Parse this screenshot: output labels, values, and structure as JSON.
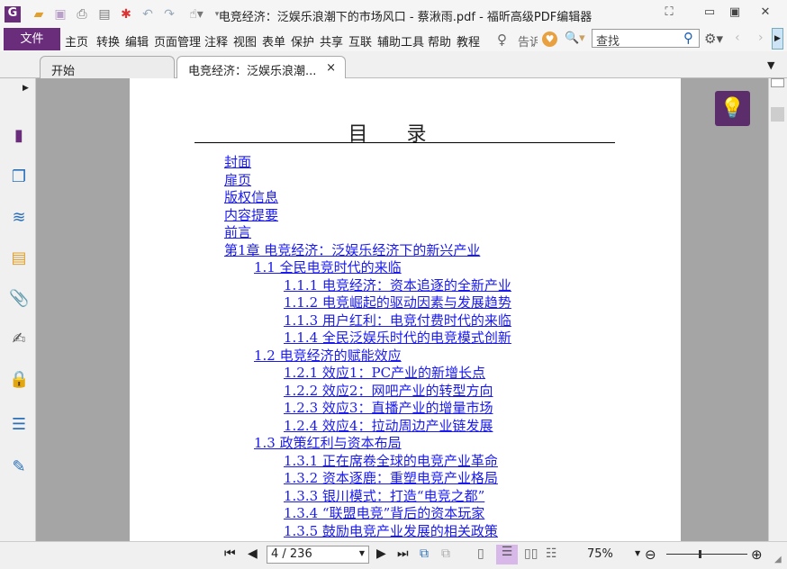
{
  "window": {
    "title": "电竞经济：泛娱乐浪潮下的市场风口 - 蔡湫雨.pdf - 福昕高级PDF编辑器"
  },
  "menu": {
    "file": "文件",
    "items": [
      "主页",
      "转换",
      "编辑",
      "页面管理",
      "注释",
      "视图",
      "表单",
      "保护",
      "共享",
      "互联",
      "辅助工具",
      "帮助",
      "教程"
    ],
    "tell": "告诉",
    "search_placeholder": "查找"
  },
  "tabs": [
    {
      "label": "开始"
    },
    {
      "label": "电竞经济：泛娱乐浪潮...",
      "close": "×"
    }
  ],
  "document": {
    "heading": "目 录",
    "toc": [
      {
        "level": 0,
        "text": "封面"
      },
      {
        "level": 0,
        "text": "扉页"
      },
      {
        "level": 0,
        "text": "版权信息"
      },
      {
        "level": 0,
        "text": "内容提要"
      },
      {
        "level": 0,
        "text": "前言"
      },
      {
        "level": 0,
        "text": "第1章 电竞经济：泛娱乐经济下的新兴产业"
      },
      {
        "level": 1,
        "text": "1.1 全民电竞时代的来临"
      },
      {
        "level": 2,
        "text": "1.1.1 电竞经济：资本追逐的全新产业"
      },
      {
        "level": 2,
        "text": "1.1.2 电竞崛起的驱动因素与发展趋势"
      },
      {
        "level": 2,
        "text": "1.1.3 用户红利：电竞付费时代的来临"
      },
      {
        "level": 2,
        "text": "1.1.4 全民泛娱乐时代的电竞模式创新"
      },
      {
        "level": 1,
        "text": "1.2 电竞经济的赋能效应"
      },
      {
        "level": 2,
        "text": "1.2.1 效应1：PC产业的新增长点"
      },
      {
        "level": 2,
        "text": "1.2.2 效应2：网吧产业的转型方向"
      },
      {
        "level": 2,
        "text": "1.2.3 效应3：直播产业的增量市场"
      },
      {
        "level": 2,
        "text": "1.2.4 效应4：拉动周边产业链发展"
      },
      {
        "level": 1,
        "text": "1.3 政策红利与资本布局"
      },
      {
        "level": 2,
        "text": "1.3.1 正在席卷全球的电竞产业革命"
      },
      {
        "level": 2,
        "text": "1.3.2 资本逐鹿：重塑电竞产业格局"
      },
      {
        "level": 2,
        "text": "1.3.3 银川模式：打造“电竞之都”"
      },
      {
        "level": 2,
        "text": "1.3.4 “联盟电竞”背后的资本玩家"
      },
      {
        "level": 2,
        "text": "1.3.5 鼓励电竞产业发展的相关政策"
      }
    ]
  },
  "status": {
    "page": "4 / 236",
    "zoom": "75%",
    "zoom_slider_fraction": 0.4
  }
}
